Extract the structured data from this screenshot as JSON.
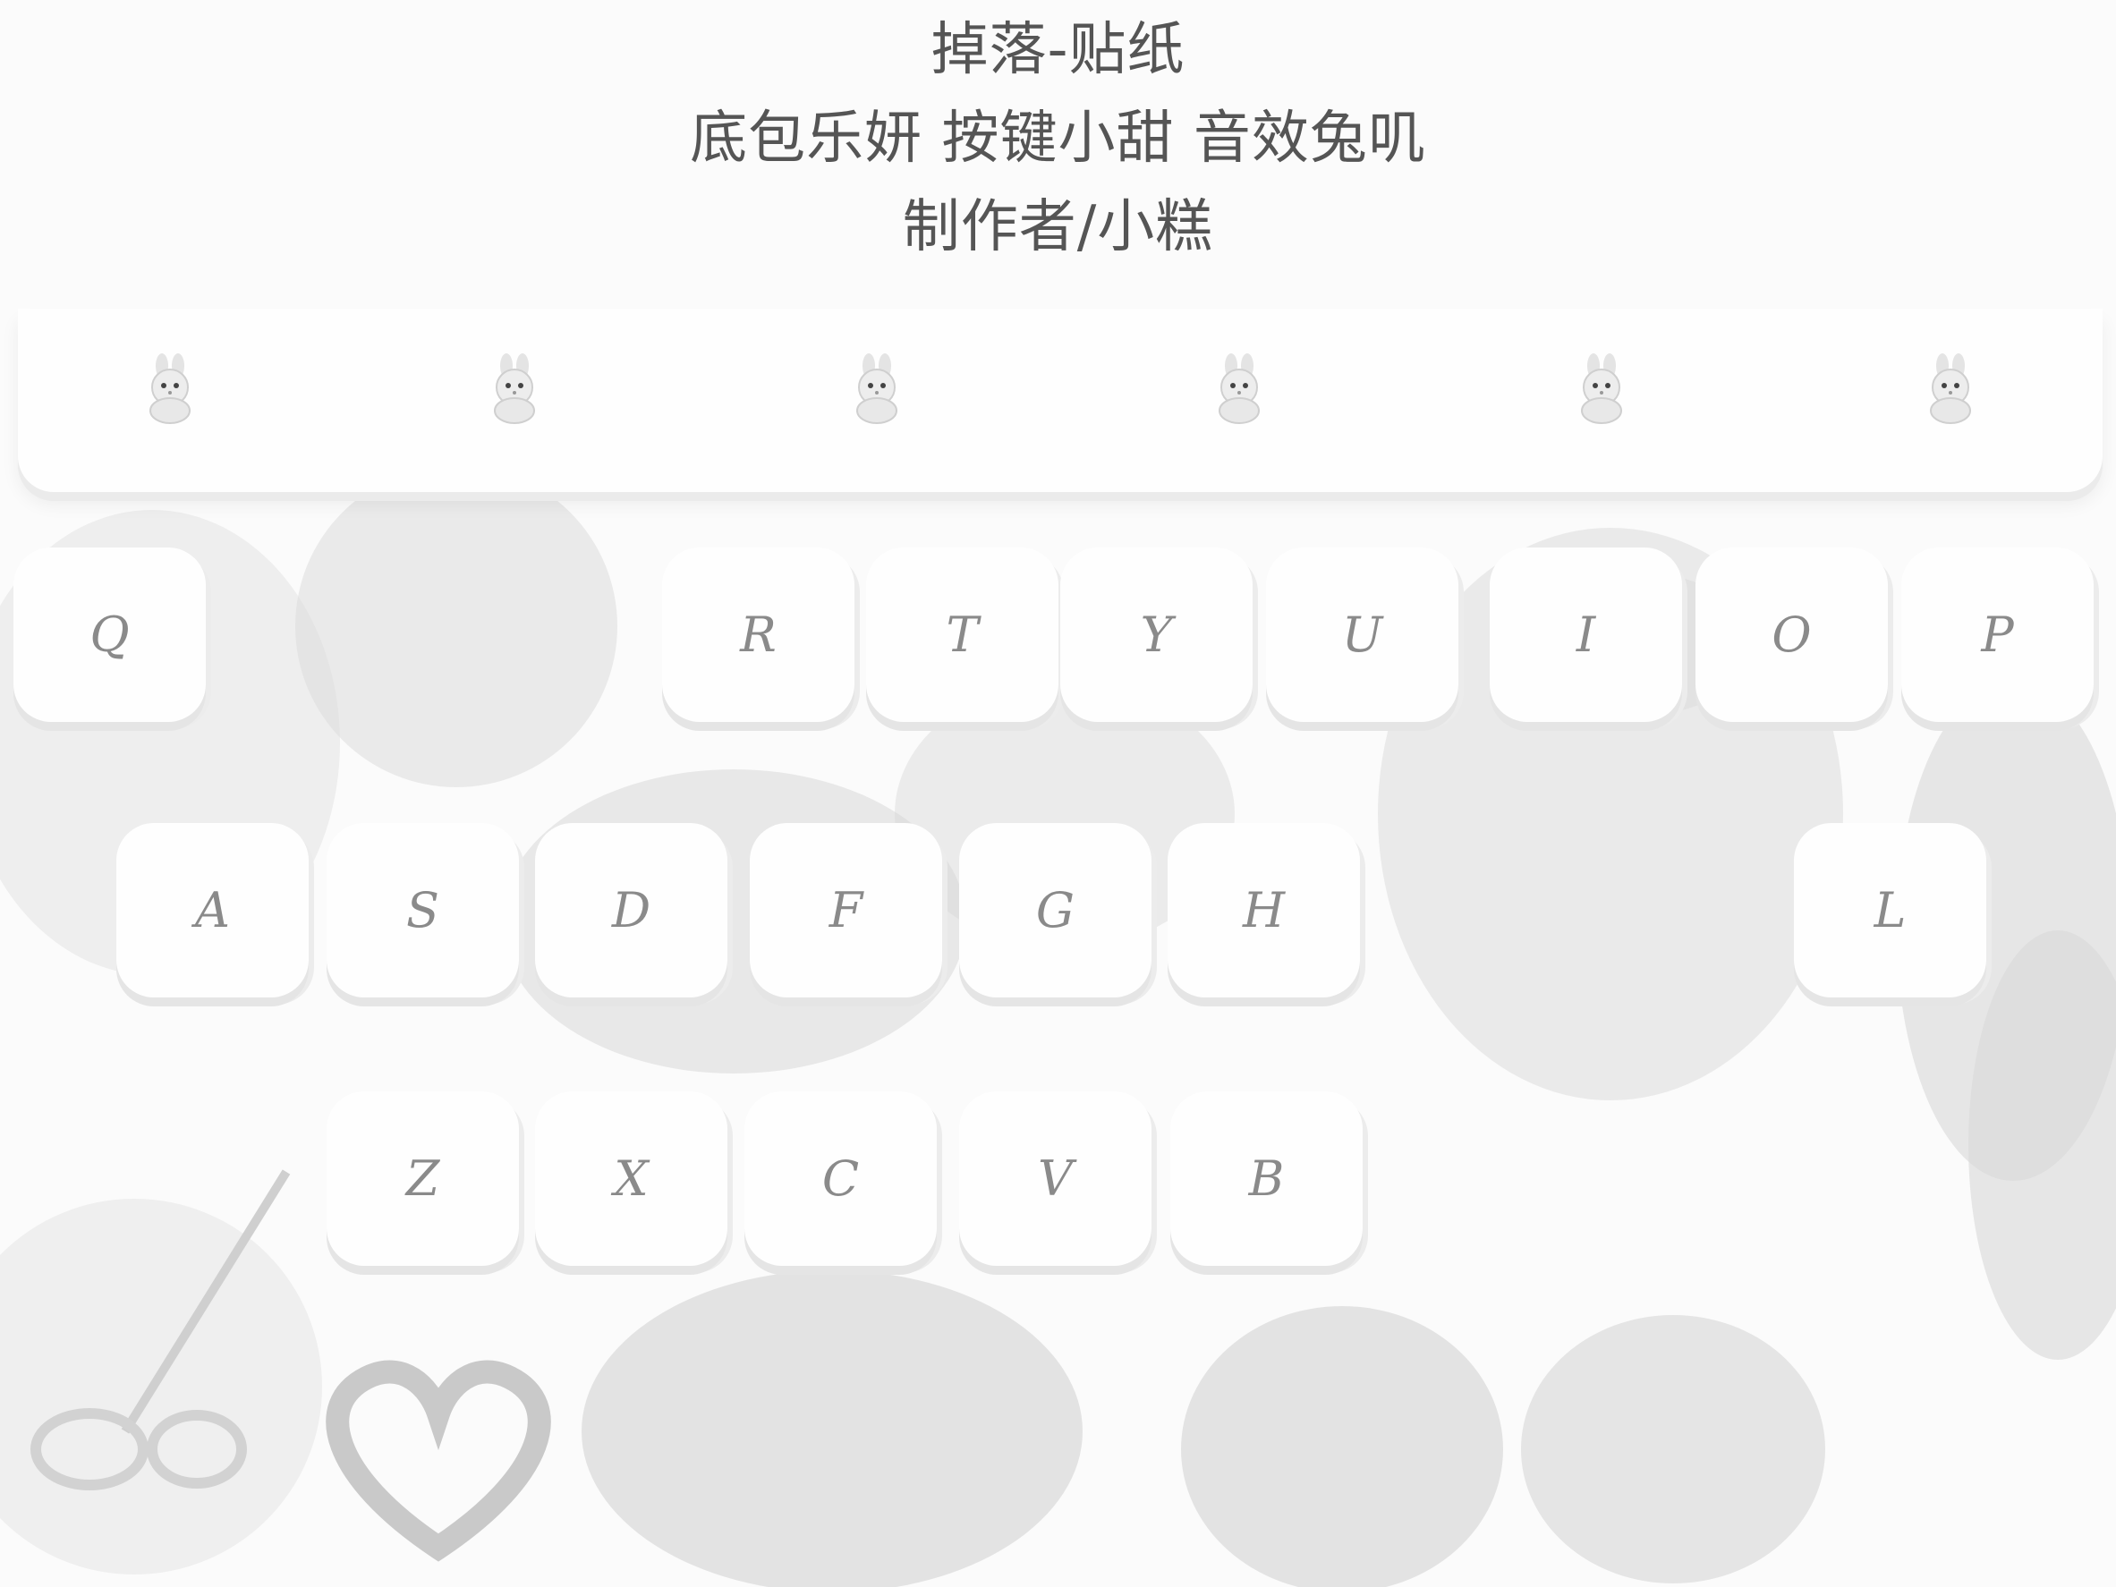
{
  "credits": {
    "title": "掉落-贴纸",
    "subtitle": "底包乐妍  按键小甜  音效兔叽",
    "author": "制作者/小糕"
  },
  "keyboard": {
    "row1": [
      "Q",
      "R",
      "T",
      "Y",
      "U",
      "I",
      "O",
      "P"
    ],
    "row2": [
      "A",
      "S",
      "D",
      "F",
      "G",
      "H",
      "L"
    ],
    "row3": [
      "Z",
      "X",
      "C",
      "V",
      "B"
    ]
  },
  "toolbar": {
    "icons": [
      "bunny-icon",
      "bunny-icon",
      "bunny-icon",
      "bunny-icon",
      "bunny-icon",
      "bunny-icon"
    ]
  },
  "colors": {
    "background": "#fbfbfb",
    "key": "#fefefe",
    "key_shadow": "#e5e5e5",
    "label": "#8a8a8a",
    "credit_text": "#555555",
    "scene_gray": "#e0e0e0"
  }
}
